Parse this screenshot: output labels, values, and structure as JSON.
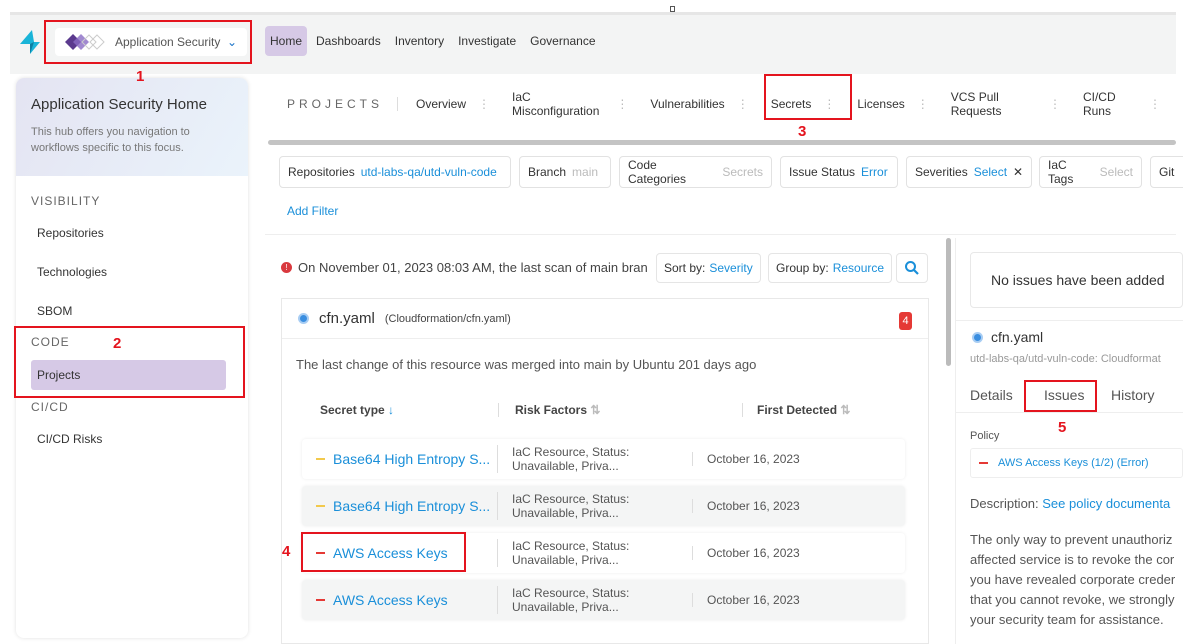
{
  "header": {
    "app_name": "Application Security",
    "nav": [
      "Home",
      "Dashboards",
      "Inventory",
      "Investigate",
      "Governance"
    ],
    "active_nav": "Home"
  },
  "sidebar": {
    "title": "Application Security Home",
    "subtitle": "This hub offers you navigation to workflows specific to this focus.",
    "sections": [
      {
        "label": "VISIBILITY",
        "items": [
          "Repositories",
          "Technologies",
          "SBOM"
        ]
      },
      {
        "label": "CODE",
        "items": [
          "Projects"
        ]
      },
      {
        "label": "CI/CD",
        "items": [
          "CI/CD Risks"
        ]
      }
    ],
    "active_item": "Projects"
  },
  "tabs": {
    "label": "PROJECTS",
    "items": [
      "Overview",
      "IaC Misconfiguration",
      "Vulnerabilities",
      "Secrets",
      "Licenses",
      "VCS Pull Requests",
      "CI/CD Runs"
    ],
    "active": "Secrets"
  },
  "filters": [
    {
      "name": "Repositories",
      "value": "utd-labs-qa/utd-vuln-code"
    },
    {
      "name": "Branch",
      "value": "main"
    },
    {
      "name": "Code Categories",
      "value": "Secrets"
    },
    {
      "name": "Issue Status",
      "value": "Error"
    },
    {
      "name": "Severities",
      "value": "Select",
      "clear": "✕"
    },
    {
      "name": "IaC Tags",
      "value": "Select"
    },
    {
      "name": "Git",
      "value": ""
    }
  ],
  "add_filter": "Add Filter",
  "scan_message": "On November 01, 2023 08:03 AM, the last scan of main bran",
  "sort": {
    "label": "Sort by:",
    "value": "Severity"
  },
  "group": {
    "label": "Group by:",
    "value": "Resource"
  },
  "resource": {
    "name": "cfn.yaml",
    "path": "(Cloudformation/cfn.yaml)",
    "count": "4",
    "last_change": "The last change of this resource was merged into main by Ubuntu 201 days ago"
  },
  "table": {
    "columns": [
      "Secret type",
      "Risk Factors",
      "First Detected"
    ],
    "rows": [
      {
        "type": "Base64 High Entropy S...",
        "risk": "IaC Resource, Status: Unavailable, Priva...",
        "date": "October 16, 2023",
        "severity_color": "#f2c94c"
      },
      {
        "type": "Base64 High Entropy S...",
        "risk": "IaC Resource, Status: Unavailable, Priva...",
        "date": "October 16, 2023",
        "severity_color": "#f2c94c"
      },
      {
        "type": "AWS Access Keys",
        "risk": "IaC Resource, Status: Unavailable, Priva...",
        "date": "October 16, 2023",
        "severity_color": "#e53935"
      },
      {
        "type": "AWS Access Keys",
        "risk": "IaC Resource, Status: Unavailable, Priva...",
        "date": "October 16, 2023",
        "severity_color": "#e53935"
      }
    ]
  },
  "panel": {
    "no_issues": "No issues have been added",
    "file": "cfn.yaml",
    "subtitle": "utd-labs-qa/utd-vuln-code: Cloudformat",
    "tabs": [
      "Details",
      "Issues",
      "History"
    ],
    "active_tab": "Issues",
    "policy_label": "Policy",
    "policy": "AWS Access Keys (1/2) (Error)",
    "description_label": "Description:",
    "description_link": "See policy documenta",
    "description_lines": [
      "The only way to prevent unauthoriz",
      "affected service is to revoke the cor",
      "you have revealed corporate creder",
      "that you cannot revoke, we strongly",
      "your security team for assistance."
    ]
  },
  "annotations": [
    "1",
    "2",
    "3",
    "4",
    "5"
  ],
  "colors": {
    "accent": "#1a8fd9",
    "active_bg": "#d6c9e6",
    "annotation": "#e4141e"
  }
}
